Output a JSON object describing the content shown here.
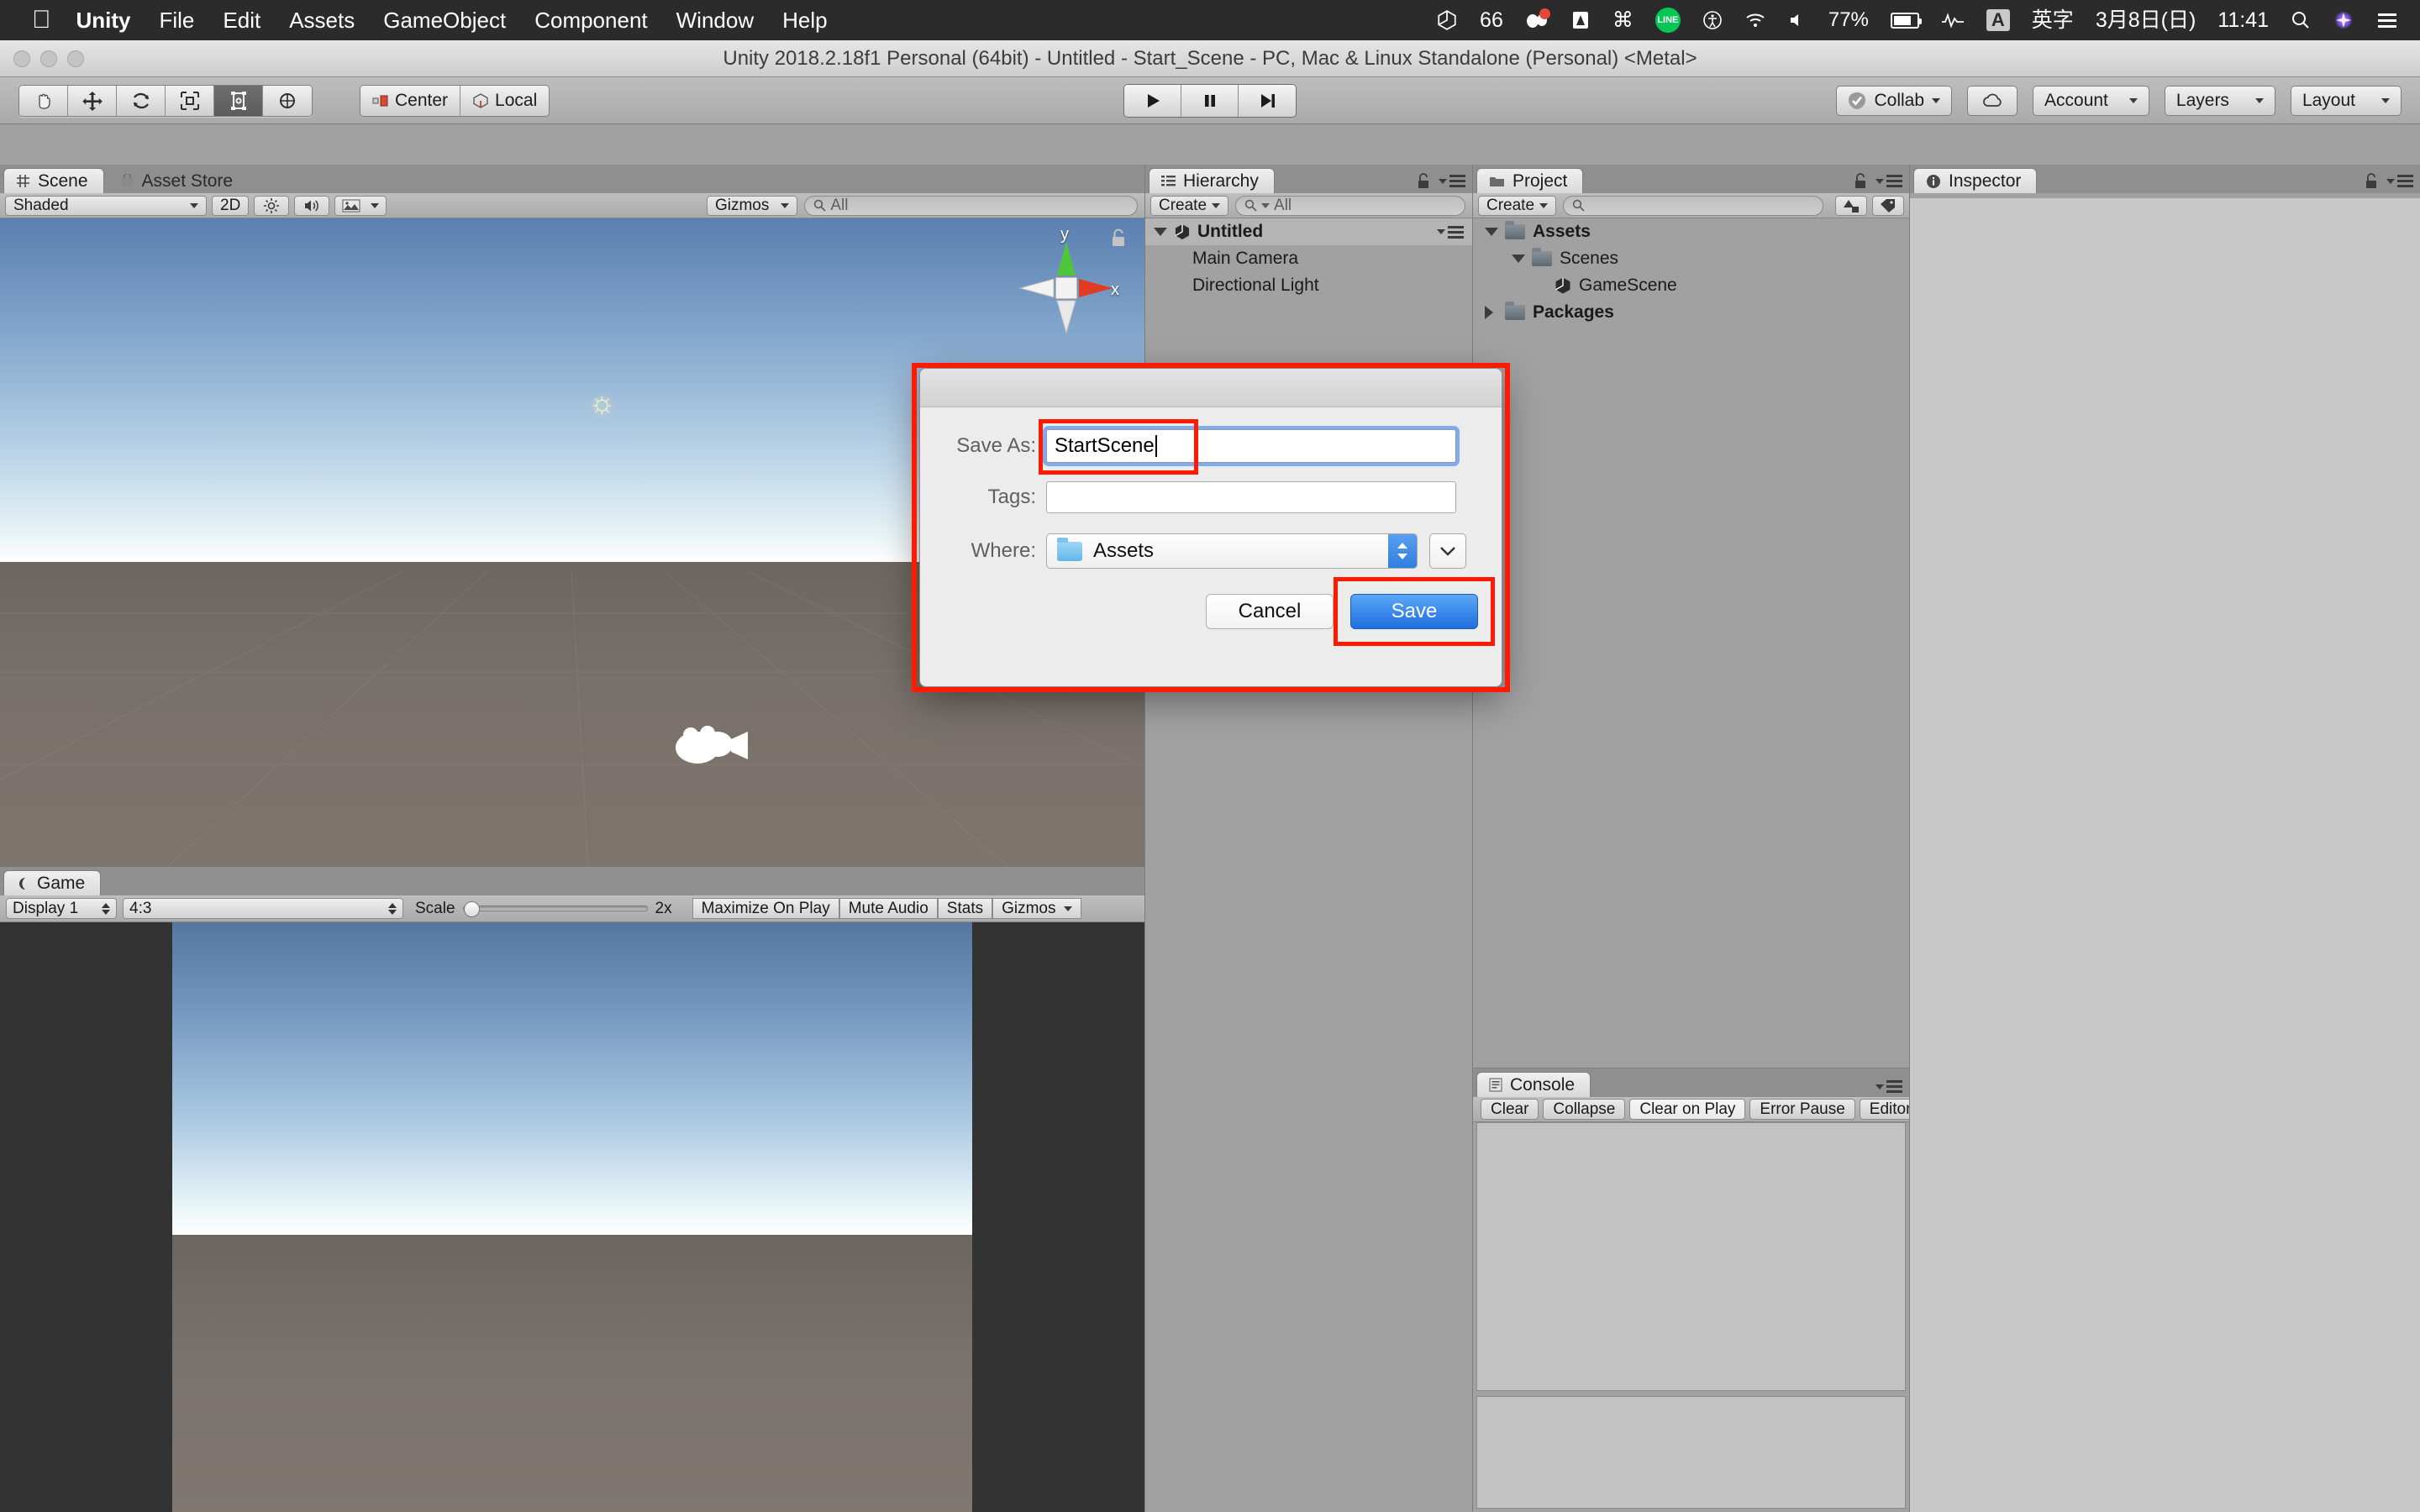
{
  "macbar": {
    "apple_icon": "apple-icon",
    "menus": [
      "Unity",
      "File",
      "Edit",
      "Assets",
      "GameObject",
      "Component",
      "Window",
      "Help"
    ],
    "status": {
      "battery_percent": "77%",
      "input_source_key": "A",
      "input_source_label": "英字",
      "date": "3月8日(日)",
      "time": "11:41",
      "line_label": "LINE",
      "icons": [
        "unity-icon",
        "glasses-icon",
        "bear-icon",
        "drive-icon",
        "command-icon",
        "line-icon",
        "accessibility-icon",
        "wifi-icon",
        "volume-icon",
        "battery-icon",
        "activity-icon",
        "search-icon",
        "siri-icon",
        "control-center-icon"
      ]
    }
  },
  "window": {
    "title": "Unity 2018.2.18f1 Personal (64bit) - Untitled - Start_Scene - PC, Mac & Linux Standalone (Personal) <Metal>"
  },
  "toolbar": {
    "transform_tools": [
      "hand-tool",
      "move-tool",
      "rotate-tool",
      "scale-tool",
      "rect-tool",
      "transform-tool"
    ],
    "active_tool_index": 4,
    "pivot_mode": "Center",
    "pivot_rotation": "Local",
    "play_controls": [
      "play-button",
      "pause-button",
      "step-button"
    ],
    "collab_label": "Collab",
    "cloud_label": "",
    "account_label": "Account",
    "layers_label": "Layers",
    "layout_label": "Layout"
  },
  "scene_view": {
    "tabs": [
      {
        "label": "Scene",
        "active": true,
        "icon": "grid-icon"
      },
      {
        "label": "Asset Store",
        "active": false,
        "icon": "store-icon"
      }
    ],
    "draw_mode": "Shaded",
    "mode_2d": "2D",
    "gizmos_label": "Gizmos",
    "search_placeholder": "All",
    "axis_labels": {
      "y": "y",
      "x": "x"
    },
    "toggles": [
      "lighting-icon",
      "audio-icon",
      "effects-icon"
    ]
  },
  "game_view": {
    "tab_label": "Game",
    "display": "Display 1",
    "aspect": "4:3",
    "scale_label": "Scale",
    "scale_value": "2x",
    "maximize_on_play": "Maximize On Play",
    "mute_audio": "Mute Audio",
    "stats": "Stats",
    "gizmos": "Gizmos"
  },
  "hierarchy": {
    "tab_label": "Hierarchy",
    "create_label": "Create",
    "search_placeholder": "All",
    "scene_name": "Untitled",
    "objects": [
      "Main Camera",
      "Directional Light"
    ]
  },
  "project": {
    "tab_label": "Project",
    "create_label": "Create",
    "search_placeholder": "",
    "tree": [
      {
        "label": "Assets",
        "depth": 0,
        "type": "folder",
        "expanded": true
      },
      {
        "label": "Scenes",
        "depth": 1,
        "type": "folder",
        "expanded": true
      },
      {
        "label": "GameScene",
        "depth": 2,
        "type": "scene",
        "expanded": false
      },
      {
        "label": "Packages",
        "depth": 0,
        "type": "folder",
        "expanded": false
      }
    ]
  },
  "console": {
    "tab_label": "Console",
    "buttons": [
      "Clear",
      "Collapse",
      "Clear on Play",
      "Error Pause",
      "Editor"
    ]
  },
  "inspector": {
    "tab_label": "Inspector"
  },
  "save_dialog": {
    "save_as_label": "Save As:",
    "file_name": "StartScene",
    "tags_label": "Tags:",
    "tags_value": "",
    "where_label": "Where:",
    "where_value": "Assets",
    "cancel_label": "Cancel",
    "save_label": "Save",
    "highlight_color": "#ff1a00"
  }
}
